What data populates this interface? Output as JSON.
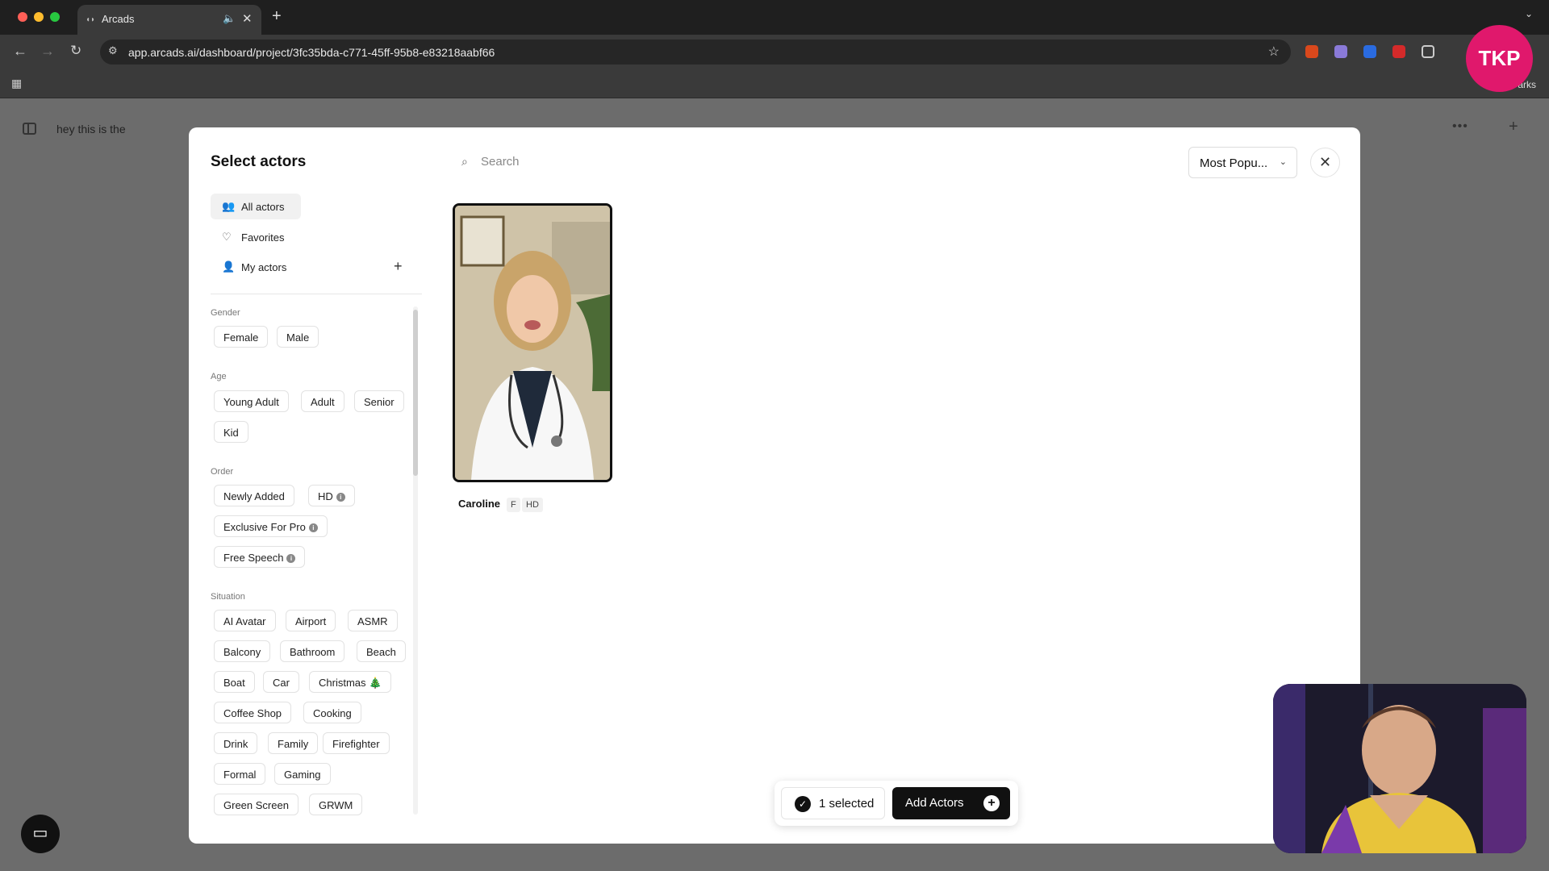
{
  "browser": {
    "tab_title": "Arcads",
    "url": "app.arcads.ai/dashboard/project/3fc35bda-c771-45ff-95b8-e83218aabf66",
    "bookmarks_label": "arks"
  },
  "page": {
    "doc_title": "hey this is the"
  },
  "modal": {
    "title": "Select actors",
    "search_placeholder": "Search",
    "sort_value": "Most Popu...",
    "nav": [
      {
        "label": "All actors"
      },
      {
        "label": "Favorites"
      },
      {
        "label": "My actors"
      }
    ],
    "filters": {
      "gender": {
        "label": "Gender",
        "options": [
          "Female",
          "Male"
        ]
      },
      "age": {
        "label": "Age",
        "options": [
          "Young Adult",
          "Adult",
          "Senior",
          "Kid"
        ]
      },
      "order": {
        "label": "Order",
        "options": [
          "Newly Added",
          "HD",
          "Exclusive For Pro",
          "Free Speech"
        ]
      },
      "situation": {
        "label": "Situation",
        "options": [
          "AI Avatar",
          "Airport",
          "ASMR",
          "Balcony",
          "Bathroom",
          "Beach",
          "Boat",
          "Car",
          "Christmas 🎄",
          "Coffee Shop",
          "Cooking",
          "Drink",
          "Family",
          "Firefighter",
          "Formal",
          "Gaming",
          "Green Screen",
          "GRWM"
        ]
      }
    },
    "actors": [
      {
        "name": "Caroline",
        "tags": [
          "F",
          "HD"
        ]
      }
    ],
    "selection": {
      "count_label": "1 selected",
      "add_label": "Add Actors"
    }
  },
  "overlay_logo": "TKP",
  "colors": {
    "accent": "#111111",
    "logo": "#e0186c"
  }
}
